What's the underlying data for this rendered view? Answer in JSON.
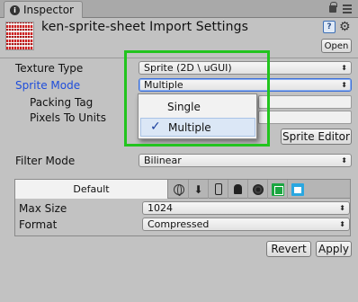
{
  "window": {
    "tab_label": "Inspector",
    "info_glyph": "i",
    "title": "ken-sprite-sheet Import Settings",
    "help_glyph": "?",
    "gear_glyph": "⚙",
    "open_label": "Open"
  },
  "properties": {
    "texture_type": {
      "label": "Texture Type",
      "value": "Sprite (2D \\ uGUI)"
    },
    "sprite_mode": {
      "label": "Sprite Mode",
      "value": "Multiple"
    },
    "packing_tag": {
      "label": "Packing Tag",
      "value": ""
    },
    "pixels_to_units": {
      "label": "Pixels To Units",
      "value": ""
    },
    "sprite_editor_label": "Sprite Editor",
    "filter_mode": {
      "label": "Filter Mode",
      "value": "Bilinear"
    }
  },
  "sprite_mode_popup": {
    "options": [
      "Single",
      "Multiple"
    ],
    "selected": "Multiple",
    "check_glyph": "✓"
  },
  "platform": {
    "default_tab": "Default",
    "tab_icons": [
      "web-icon",
      "download-icon",
      "phone-icon",
      "android-icon",
      "blackberry-icon",
      "windows-phone-icon",
      "windows-store-icon"
    ],
    "download_glyph": "⬇",
    "max_size": {
      "label": "Max Size",
      "value": "1024"
    },
    "format": {
      "label": "Format",
      "value": "Compressed"
    }
  },
  "buttons": {
    "revert": "Revert",
    "apply": "Apply"
  },
  "colors": {
    "highlight": "#22c41e",
    "selection_label": "#1e4ddb",
    "background": "#c2c2c2"
  },
  "arrow_glyph": "⬍"
}
